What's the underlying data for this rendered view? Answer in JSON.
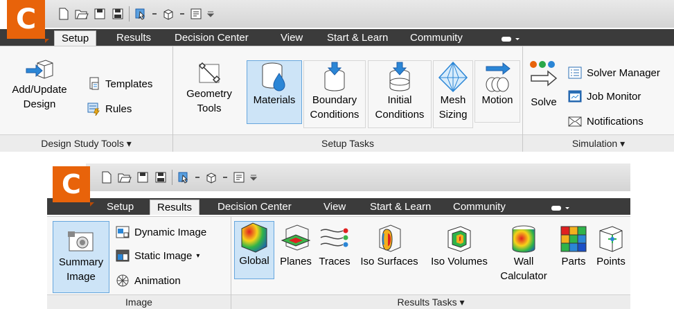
{
  "ribbon1": {
    "app_letter": "C",
    "tabs": {
      "setup": "Setup",
      "results": "Results",
      "decision": "Decision Center",
      "view": "View",
      "start": "Start & Learn",
      "community": "Community"
    },
    "panels": {
      "design": {
        "title": "Design Study Tools ▾",
        "add_update_l1": "Add/Update",
        "add_update_l2": "Design",
        "templates": "Templates",
        "rules": "Rules"
      },
      "setup": {
        "title": "Setup Tasks",
        "geometry_l1": "Geometry",
        "geometry_l2": "Tools",
        "materials": "Materials",
        "boundary_l1": "Boundary",
        "boundary_l2": "Conditions",
        "initial_l1": "Initial",
        "initial_l2": "Conditions",
        "mesh_l1": "Mesh",
        "mesh_l2": "Sizing",
        "motion": "Motion"
      },
      "simulation": {
        "title": "Simulation ▾",
        "solve": "Solve",
        "solver_manager": "Solver Manager",
        "job_monitor": "Job Monitor",
        "notifications": "Notifications"
      }
    }
  },
  "ribbon2": {
    "app_letter": "C",
    "tabs": {
      "setup": "Setup",
      "results": "Results",
      "decision": "Decision Center",
      "view": "View",
      "start": "Start & Learn",
      "community": "Community"
    },
    "panels": {
      "image": {
        "title": "Image",
        "summary_l1": "Summary",
        "summary_l2": "Image",
        "dynamic": "Dynamic Image",
        "static": "Static Image",
        "animation": "Animation"
      },
      "results": {
        "title": "Results Tasks ▾",
        "global": "Global",
        "planes": "Planes",
        "traces": "Traces",
        "iso_surfaces": "Iso Surfaces",
        "iso_volumes": "Iso Volumes",
        "wall_l1": "Wall",
        "wall_l2": "Calculator",
        "parts": "Parts",
        "points": "Points"
      }
    }
  },
  "colors": {
    "accent": "#e8630a",
    "tab_bar": "#3b3b3b",
    "selected": "#cde4f7",
    "selected_border": "#66a6dd",
    "icon_blue": "#2b86d6"
  },
  "icons": [
    "new-file-icon",
    "open-folder-icon",
    "save-icon",
    "save-as-icon",
    "select-icon",
    "cube-icon",
    "properties-icon",
    "customize-icon",
    "cloud-icon"
  ]
}
